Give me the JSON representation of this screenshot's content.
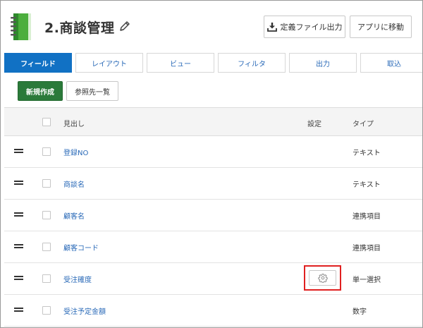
{
  "header": {
    "app_title": "2.商談管理",
    "export_button": "定義ファイル出力",
    "goto_app_button": "アプリに移動"
  },
  "tabs": [
    {
      "label": "フィールド",
      "active": true
    },
    {
      "label": "レイアウト",
      "active": false
    },
    {
      "label": "ビュー",
      "active": false
    },
    {
      "label": "フィルタ",
      "active": false
    },
    {
      "label": "出力",
      "active": false
    },
    {
      "label": "取込",
      "active": false
    }
  ],
  "actions": {
    "new_button": "新規作成",
    "reference_list_button": "参照先一覧"
  },
  "table": {
    "headers": {
      "title": "見出し",
      "settings": "設定",
      "type": "タイプ"
    },
    "rows": [
      {
        "name": "登録NO",
        "type": "テキスト",
        "has_settings": false
      },
      {
        "name": "商談名",
        "type": "テキスト",
        "has_settings": false
      },
      {
        "name": "顧客名",
        "type": "連携項目",
        "has_settings": false
      },
      {
        "name": "顧客コード",
        "type": "連携項目",
        "has_settings": false
      },
      {
        "name": "受注確度",
        "type": "単一選択",
        "has_settings": true
      },
      {
        "name": "受注予定金額",
        "type": "数字",
        "has_settings": false
      }
    ]
  },
  "colors": {
    "accent_blue": "#1171c4",
    "link_blue": "#2a6ab8",
    "primary_green": "#2b7a3a",
    "highlight_red": "#e02020",
    "app_icon_green": "#3aa03a"
  },
  "icons": {
    "app": "notebook-icon",
    "edit": "pencil-icon",
    "export": "download-icon",
    "drag": "drag-handle-icon",
    "settings": "gear-icon"
  }
}
